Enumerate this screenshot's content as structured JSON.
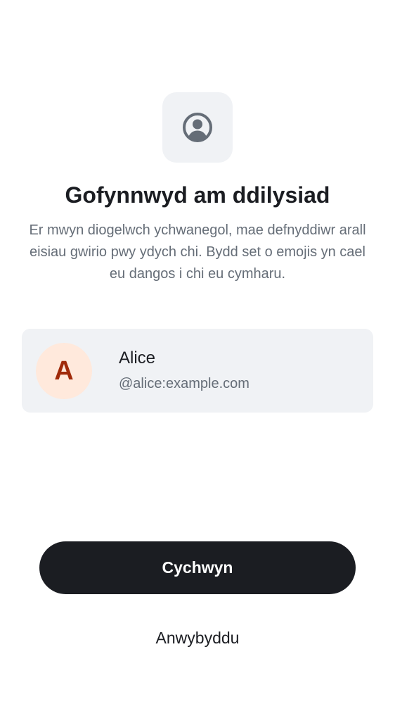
{
  "header": {
    "icon": "user-profile-icon",
    "title": "Gofynnwyd am ddilysiad",
    "subtitle": "Er mwyn diogelwch ychwanegol, mae defnyddiwr arall eisiau gwirio pwy ydych chi. Bydd set o emojis yn cael eu dangos i chi eu cymharu."
  },
  "user": {
    "avatar_letter": "A",
    "name": "Alice",
    "id": "@alice:example.com"
  },
  "actions": {
    "start_label": "Cychwyn",
    "ignore_label": "Anwybyddu"
  },
  "colors": {
    "background": "#ffffff",
    "card_background": "#f0f2f5",
    "primary_button": "#1b1d22",
    "secondary_text": "#656d77",
    "avatar_background": "#ffe9dc",
    "avatar_text": "#a02a0a",
    "icon": "#656d77"
  }
}
